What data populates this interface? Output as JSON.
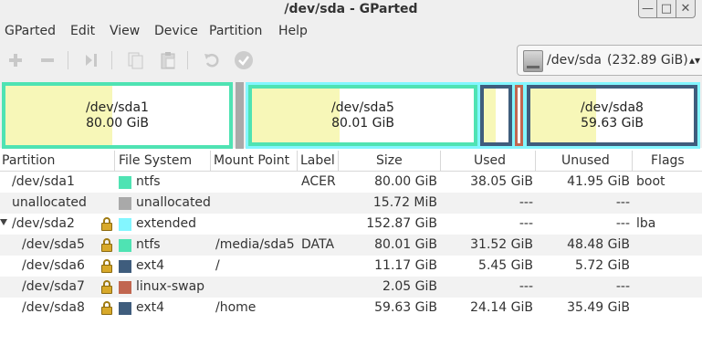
{
  "window": {
    "title": "/dev/sda - GParted",
    "minimize_glyph": "—",
    "maximize_glyph": "□",
    "close_glyph": "✕"
  },
  "menu": [
    "GParted",
    "Edit",
    "View",
    "Device",
    "Partition",
    "Help"
  ],
  "toolbar": {
    "icons": [
      "new-partition-icon",
      "delete-partition-icon",
      "resize-move-icon",
      "copy-icon",
      "paste-icon",
      "undo-icon",
      "apply-icon"
    ],
    "device": {
      "name": "/dev/sda",
      "size": "(232.89 GiB)",
      "arrow": "▴▾"
    }
  },
  "map": {
    "sda1": {
      "name": "/dev/sda1",
      "size": "80.00 GiB",
      "used_fraction": 0.476
    },
    "sda5": {
      "name": "/dev/sda5",
      "size": "80.01 GiB",
      "used_fraction": 0.394
    },
    "sda8": {
      "name": "/dev/sda8",
      "size": "59.63 GiB",
      "used_fraction": 0.405
    }
  },
  "colors": {
    "ntfs": "#4fe3b3",
    "unallocated": "#a9a9a9",
    "extended": "#83f6ff",
    "ext4": "#3f5d7d",
    "linux_swap": "#c16650",
    "used_fill": "#f7f7b8"
  },
  "table": {
    "headers": {
      "partition": "Partition",
      "filesystem": "File System",
      "mount": "Mount Point",
      "label": "Label",
      "size": "Size",
      "used": "Used",
      "unused": "Unused",
      "flags": "Flags"
    },
    "rows": [
      {
        "partition": "/dev/sda1",
        "fs": "ntfs",
        "mount": "",
        "label": "ACER",
        "size": "80.00 GiB",
        "used": "38.05 GiB",
        "unused": "41.95 GiB",
        "flags": "boot"
      },
      {
        "partition": "unallocated",
        "fs": "unallocated",
        "mount": "",
        "label": "",
        "size": "15.72 MiB",
        "used": "---",
        "unused": "---",
        "flags": ""
      },
      {
        "partition": "/dev/sda2",
        "fs": "extended",
        "mount": "",
        "label": "",
        "size": "152.87 GiB",
        "used": "---",
        "unused": "---",
        "flags": "lba"
      },
      {
        "partition": "/dev/sda5",
        "fs": "ntfs",
        "mount": "/media/sda5",
        "label": "DATA",
        "size": "80.01 GiB",
        "used": "31.52 GiB",
        "unused": "48.48 GiB",
        "flags": ""
      },
      {
        "partition": "/dev/sda6",
        "fs": "ext4",
        "mount": "/",
        "label": "",
        "size": "11.17 GiB",
        "used": "5.45 GiB",
        "unused": "5.72 GiB",
        "flags": ""
      },
      {
        "partition": "/dev/sda7",
        "fs": "linux-swap",
        "mount": "",
        "label": "",
        "size": "2.05 GiB",
        "used": "---",
        "unused": "---",
        "flags": ""
      },
      {
        "partition": "/dev/sda8",
        "fs": "ext4",
        "mount": "/home",
        "label": "",
        "size": "59.63 GiB",
        "used": "24.14 GiB",
        "unused": "35.49 GiB",
        "flags": ""
      }
    ]
  }
}
